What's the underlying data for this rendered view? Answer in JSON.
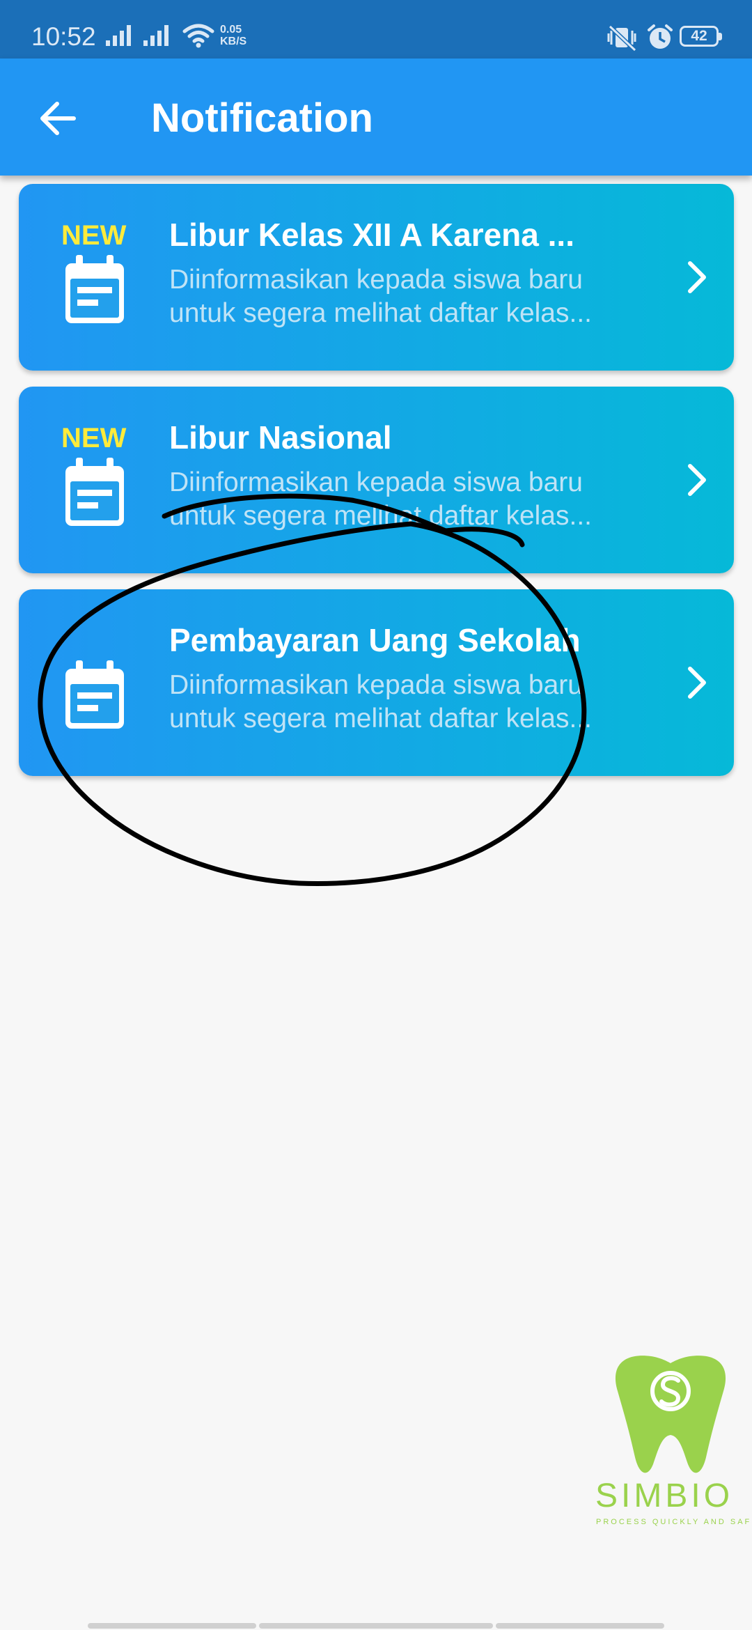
{
  "status_bar": {
    "time": "10:52",
    "net_speed_value": "0.05",
    "net_speed_unit": "KB/S",
    "battery": "42",
    "icons": [
      "signal-icon",
      "signal-icon",
      "wifi-icon",
      "vibrate-mute-icon",
      "alarm-icon",
      "battery-icon"
    ]
  },
  "app_bar": {
    "title": "Notification",
    "back_icon": "arrow-back-icon",
    "color": "#2196f3"
  },
  "notifications": [
    {
      "badge": "NEW",
      "title": "Libur Kelas XII A Karena ...",
      "body": "Diinformasikan kepada siswa baru untuk segera melihat daftar kelas...",
      "icon": "calendar-icon"
    },
    {
      "badge": "NEW",
      "title": "Libur Nasional",
      "body": "Diinformasikan kepada siswa baru untuk segera melihat daftar kelas...",
      "icon": "calendar-icon"
    },
    {
      "badge": "",
      "title": "Pembayaran Uang Sekolah",
      "body": "Diinformasikan kepada siswa baru untuk segera melihat daftar kelas...",
      "icon": "calendar-icon"
    }
  ],
  "card_gradient": [
    "#2196f3",
    "#06b9d8"
  ],
  "badge_color": "#ffeb3b",
  "watermark": {
    "name": "SIMBIO",
    "tagline": "PROCESS  QUICKLY  AND  SAFELY",
    "color": "#9ad24c"
  }
}
